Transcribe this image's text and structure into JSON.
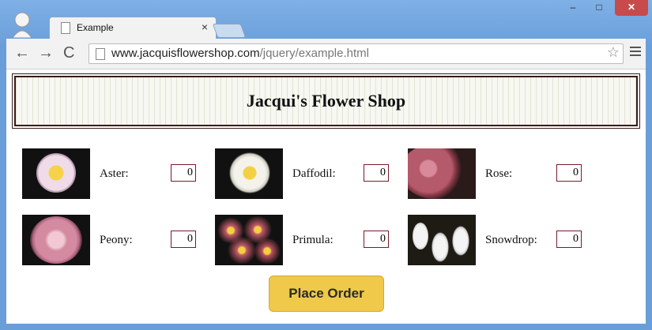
{
  "browser": {
    "tab_title": "Example",
    "tab_close": "×",
    "url_domain": "www.jacquisflowershop.com",
    "url_path": "/jquery/example.html",
    "nav_back": "←",
    "nav_forward": "→",
    "nav_reload": "C",
    "window_minimize": "–",
    "window_maximize": "□",
    "window_close": "✕"
  },
  "page": {
    "title": "Jacqui's Flower Shop",
    "order_button": "Place Order",
    "flowers": [
      {
        "name": "Aster:",
        "qty": "0"
      },
      {
        "name": "Daffodil:",
        "qty": "0"
      },
      {
        "name": "Rose:",
        "qty": "0"
      },
      {
        "name": "Peony:",
        "qty": "0"
      },
      {
        "name": "Primula:",
        "qty": "0"
      },
      {
        "name": "Snowdrop:",
        "qty": "0"
      }
    ]
  },
  "colors": {
    "chrome_frame": "#6fa1da",
    "button": "#f0c84a",
    "input_border": "#7a1a2a"
  }
}
